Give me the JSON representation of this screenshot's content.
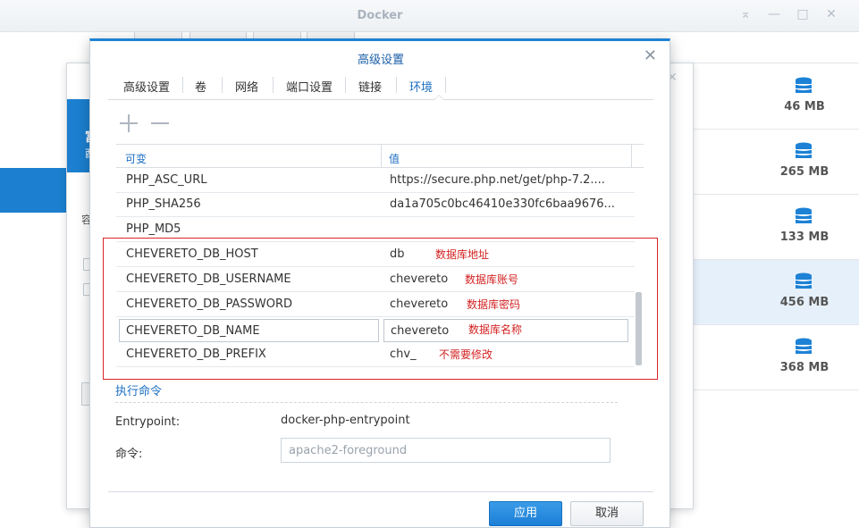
{
  "window": {
    "title": "Docker"
  },
  "window_controls": {
    "pin": "⌅",
    "minimize": "—",
    "maximize": "□",
    "close": "✕"
  },
  "images": [
    {
      "size": "46 MB",
      "selected": false
    },
    {
      "size": "265 MB",
      "selected": false
    },
    {
      "size": "133 MB",
      "selected": false
    },
    {
      "size": "456 MB",
      "selected": true
    },
    {
      "size": "368 MB",
      "selected": false
    }
  ],
  "background_dialog": {
    "band_char_1": "富",
    "band_char_2": "酉",
    "label_char": "容"
  },
  "dialog": {
    "title": "高级设置",
    "close": "✕",
    "tabs": [
      {
        "label": "高级设置",
        "active": false
      },
      {
        "label": "卷",
        "active": false
      },
      {
        "label": "网络",
        "active": false
      },
      {
        "label": "端口设置",
        "active": false
      },
      {
        "label": "链接",
        "active": false
      },
      {
        "label": "环境",
        "active": true
      }
    ],
    "toolbar": {
      "add_icon": "plus-icon",
      "remove_icon": "minus-icon"
    },
    "env_table": {
      "columns": [
        "可变",
        "值"
      ],
      "rows": [
        {
          "key": "PHP_ASC_URL",
          "value": "https://secure.php.net/get/php-7.2....",
          "note": ""
        },
        {
          "key": "PHP_SHA256",
          "value": "da1a705c0bc46410e330fc6baa9676...",
          "note": ""
        },
        {
          "key": "PHP_MD5",
          "value": "",
          "note": ""
        },
        {
          "key": "CHEVERETO_DB_HOST",
          "value": "db",
          "note": "数据库地址"
        },
        {
          "key": "CHEVERETO_DB_USERNAME",
          "value": "chevereto",
          "note": "数据库账号"
        },
        {
          "key": "CHEVERETO_DB_PASSWORD",
          "value": "chevereto",
          "note": "数据库密码"
        },
        {
          "key": "CHEVERETO_DB_NAME",
          "value": "chevereto",
          "note": "数据库名称"
        },
        {
          "key": "CHEVERETO_DB_PREFIX",
          "value": "chv_",
          "note": "不需要修改"
        }
      ]
    },
    "exec": {
      "title": "执行命令",
      "entrypoint_label": "Entrypoint:",
      "entrypoint_value": "docker-php-entrypoint",
      "command_label": "命令:",
      "command_placeholder": "apache2-foreground"
    },
    "buttons": {
      "apply": "应用",
      "cancel": "取消"
    }
  },
  "colors": {
    "accent": "#1d82d6",
    "annotation": "#d9242a",
    "selected_row": "#e6f0fb"
  }
}
